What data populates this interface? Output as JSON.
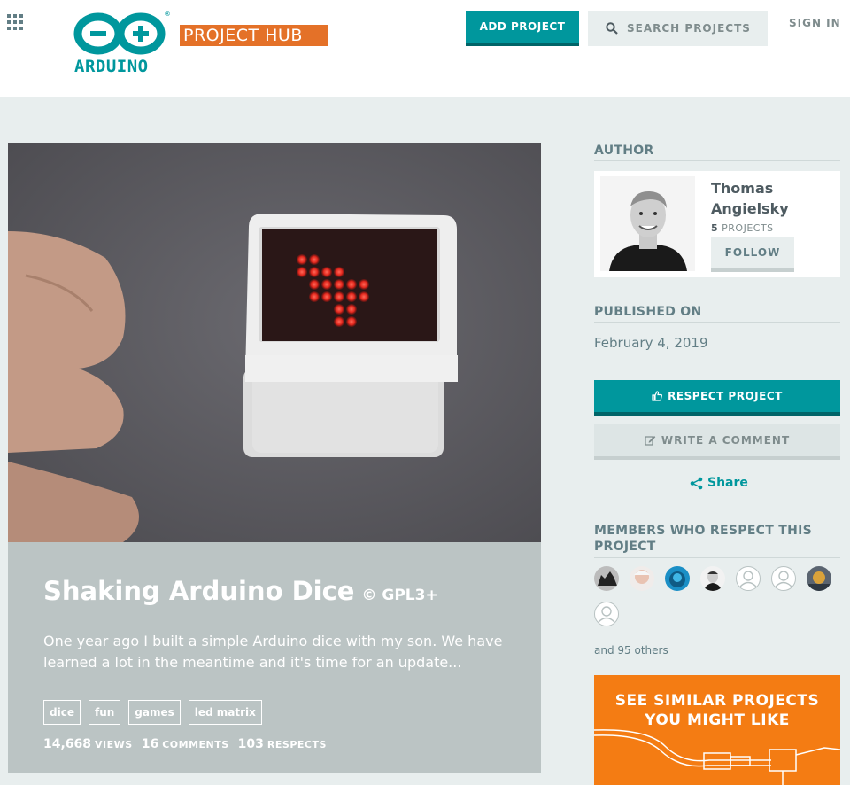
{
  "header": {
    "logo_word": "ARDUINO",
    "product_badge": "PROJECT HUB",
    "add_project_label": "ADD PROJECT",
    "search_placeholder": "SEARCH PROJECTS",
    "sign_in_label": "SIGN IN"
  },
  "project": {
    "title": "Shaking Arduino Dice",
    "license": "© GPL3+",
    "description": "One year ago I built a simple Arduino dice with my son. We have learned a lot in the meantime and it's time for an update...",
    "tags": [
      "dice",
      "fun",
      "games",
      "led matrix"
    ],
    "stats": [
      {
        "value": "14,668",
        "label": "VIEWS"
      },
      {
        "value": "16",
        "label": "COMMENTS"
      },
      {
        "value": "103",
        "label": "RESPECTS"
      }
    ]
  },
  "sidebar": {
    "author_heading": "AUTHOR",
    "author_name": "Thomas Angielsky",
    "author_projects_count": "5",
    "author_projects_label": "PROJECTS",
    "follow_label": "FOLLOW",
    "published_heading": "PUBLISHED ON",
    "published_date": "February 4, 2019",
    "respect_label": "RESPECT PROJECT",
    "comment_label": "WRITE A COMMENT",
    "share_label": "Share",
    "members_heading": "MEMBERS WHO RESPECT THIS PROJECT",
    "others_text": "and 95 others",
    "similar_label": "SEE SIMILAR PROJECTS YOU MIGHT LIKE"
  },
  "colors": {
    "teal": "#00979d",
    "orange": "#e47128",
    "similar_orange": "#f47c13",
    "page_bg": "#e8eeee",
    "hero_panel": "#bbc4c4"
  },
  "icons": [
    "apps-grid-icon",
    "search-icon",
    "thumbs-up-icon",
    "pencil-icon",
    "share-icon",
    "user-placeholder-icon"
  ]
}
